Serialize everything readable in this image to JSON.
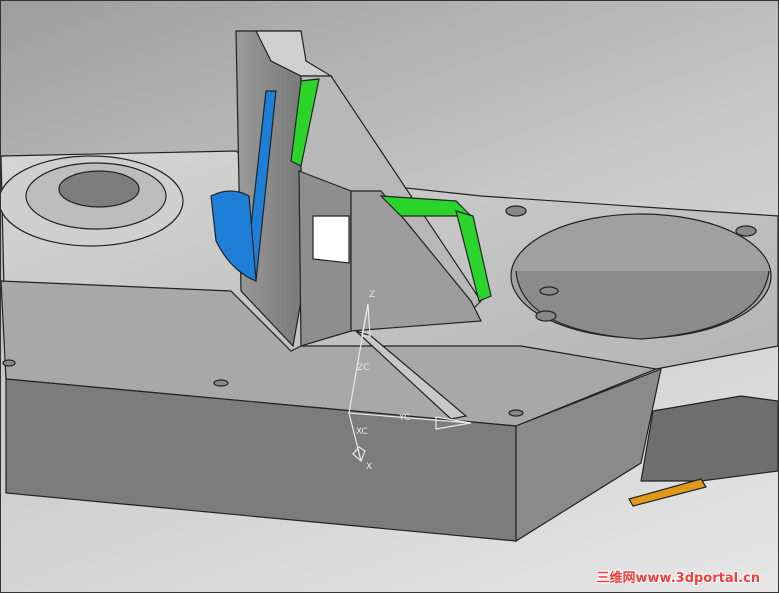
{
  "viewport": {
    "triad": {
      "z": "Z",
      "zc": "ZC",
      "yc": "YC",
      "xc": "XC",
      "x": "X"
    },
    "watermark": "三维网www.3dportal.cn",
    "colors": {
      "body": "#8c8c8c",
      "face_top": "#c6c6c6",
      "blue": "#1e7fd8",
      "green": "#2bd42b",
      "orange": "#e09a1a"
    }
  }
}
